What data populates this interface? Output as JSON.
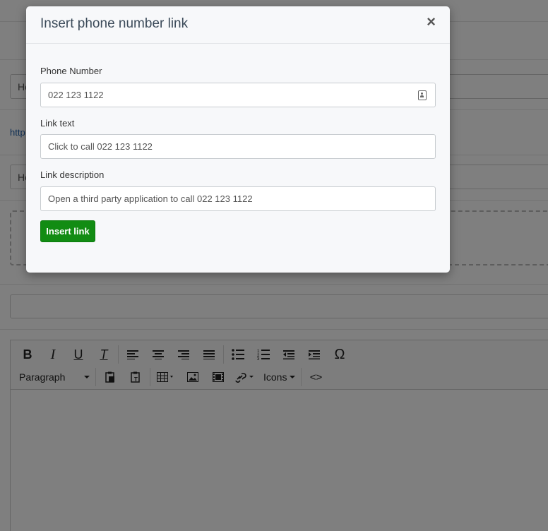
{
  "background": {
    "field1_text": "He",
    "link_text": "http",
    "field2_text": "He"
  },
  "editor": {
    "toolbar_row1": [
      {
        "icon": "bold-icon",
        "glyph": "B"
      },
      {
        "icon": "italic-icon",
        "glyph": "I"
      },
      {
        "icon": "underline-icon",
        "glyph": "U"
      },
      {
        "icon": "clear-format-icon",
        "glyph": "T"
      },
      {
        "icon": "align-left-icon",
        "glyph": ""
      },
      {
        "icon": "align-center-icon",
        "glyph": ""
      },
      {
        "icon": "align-right-icon",
        "glyph": ""
      },
      {
        "icon": "align-justify-icon",
        "glyph": ""
      },
      {
        "icon": "bullet-list-icon",
        "glyph": ""
      },
      {
        "icon": "numbered-list-icon",
        "glyph": ""
      },
      {
        "icon": "outdent-icon",
        "glyph": ""
      },
      {
        "icon": "indent-icon",
        "glyph": ""
      },
      {
        "icon": "special-char-icon",
        "glyph": "Ω"
      }
    ],
    "format_select": "Paragraph",
    "icons_menu": "Icons",
    "code_icon": "<>"
  },
  "modal": {
    "title": "Insert phone number link",
    "close_glyph": "×",
    "phone_label": "Phone Number",
    "phone_value": "022 123 1122",
    "link_text_label": "Link text",
    "link_text_value": "Click to call 022 123 1122",
    "link_desc_label": "Link description",
    "link_desc_value": "Open a third party application to call 022 123 1122",
    "insert_button": "Insert link"
  },
  "colors": {
    "insert_button": "#128c13",
    "overlay": "rgba(0,0,0,0.5)",
    "link": "#1f5fa8"
  }
}
